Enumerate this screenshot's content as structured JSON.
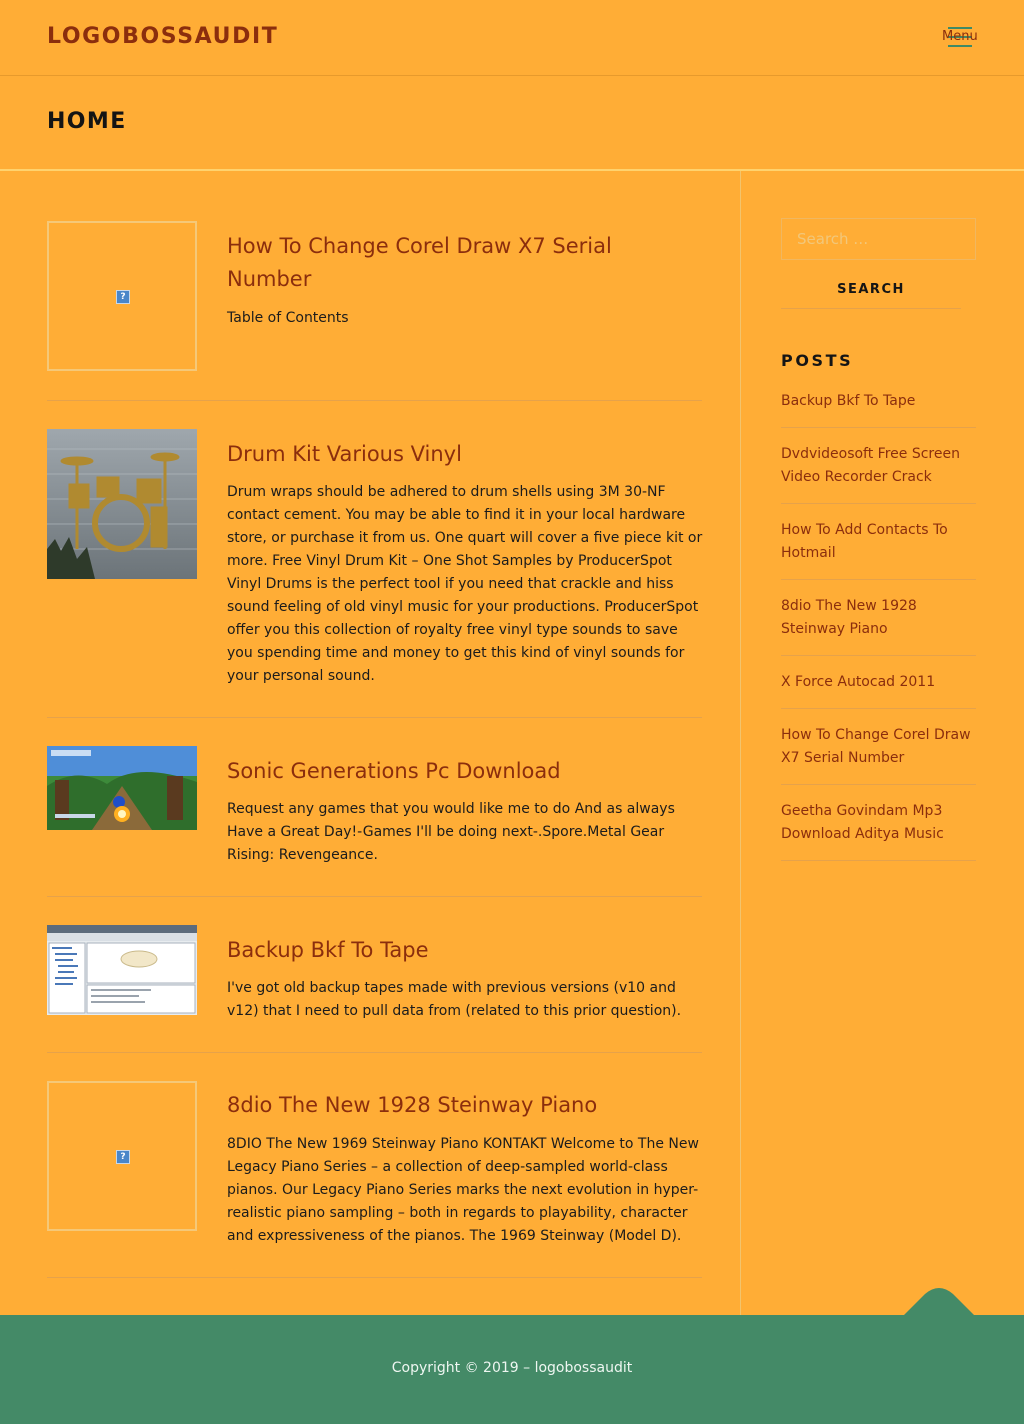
{
  "header": {
    "logo": "LOGOBOSSAUDIT",
    "menu_label": "Menu"
  },
  "page": {
    "title": "HOME"
  },
  "posts": [
    {
      "title": "How To Change Corel Draw X7 Serial Number",
      "excerpt": "Table of Contents",
      "image": "broken-image"
    },
    {
      "title": "Drum Kit Various Vinyl",
      "excerpt": "Drum wraps should be adhered to drum shells using 3M 30-NF contact cement. You may be able to find it in your local hardware store, or purchase it from us. One quart will cover a five piece kit or more. Free Vinyl Drum Kit – One Shot Samples by ProducerSpot Vinyl Drums is the perfect tool if you need that crackle and hiss sound feeling of old vinyl music for your productions. ProducerSpot offer you this collection of royalty free vinyl type sounds to save you spending time and money to get this kind of vinyl sounds for your personal sound.",
      "image": "drum-kit-photo"
    },
    {
      "title": "Sonic Generations Pc Download",
      "excerpt": "Request any games that you would like me to do And as always Have a Great Day!-Games I'll be doing next-.Spore.Metal Gear Rising: Revengeance.",
      "image": "game-screenshot"
    },
    {
      "title": "Backup Bkf To Tape",
      "excerpt": "I've got old backup tapes made with previous versions (v10 and v12) that I need to pull data from (related to this prior question).",
      "image": "software-screenshot"
    },
    {
      "title": "8dio The New 1928 Steinway Piano",
      "excerpt": "8DIO The New 1969 Steinway Piano KONTAKT Welcome to The New Legacy Piano Series – a collection of deep-sampled world-class pianos. Our Legacy Piano Series marks the next evolution in hyper-realistic piano sampling – both in regards to playability, character and expressiveness of the pianos. The 1969 Steinway (Model D).",
      "image": "broken-image"
    }
  ],
  "sidebar": {
    "search_placeholder": "Search …",
    "search_button": "SEARCH",
    "widget_title": "POSTS",
    "links": [
      "Backup Bkf To Tape",
      "Dvdvideosoft Free Screen Video Recorder Crack",
      "How To Add Contacts To Hotmail",
      "8dio The New 1928 Steinway Piano",
      "X Force Autocad 2011",
      "How To Change Corel Draw X7 Serial Number",
      "Geetha Govindam Mp3 Download Aditya Music"
    ]
  },
  "footer": {
    "copyright": "Copyright © 2019 – logobossaudit"
  },
  "colors": {
    "background": "#ffad36",
    "link": "#8b2e0d",
    "footer": "#448a67"
  }
}
